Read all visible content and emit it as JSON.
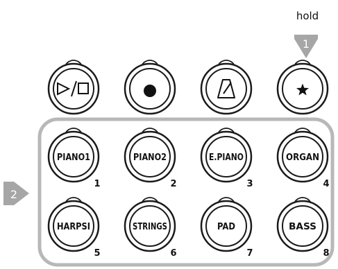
{
  "annotations": {
    "hold_label": "hold",
    "marker_1": "1",
    "marker_2": "2"
  },
  "top_buttons": [
    {
      "id": "play-stop",
      "icon": "play-stop-icon",
      "text": "▷/□"
    },
    {
      "id": "record",
      "icon": "record-dot-icon"
    },
    {
      "id": "metronome",
      "icon": "metronome-icon"
    },
    {
      "id": "favorite",
      "icon": "star-icon",
      "text": "★"
    }
  ],
  "voice_buttons": [
    {
      "label": "PIANO1",
      "number": "1"
    },
    {
      "label": "PIANO2",
      "number": "2"
    },
    {
      "label": "E.PIANO",
      "number": "3"
    },
    {
      "label": "ORGAN",
      "number": "4"
    },
    {
      "label": "HARPSI",
      "number": "5"
    },
    {
      "label": "STRINGS",
      "number": "6"
    },
    {
      "label": "PAD",
      "number": "7"
    },
    {
      "label": "BASS",
      "number": "8"
    }
  ],
  "colors": {
    "marker": "#a6a6a6",
    "group_outline": "#b8b8b8",
    "button_stroke": "#1a1a1a",
    "button_text": "#111111"
  }
}
